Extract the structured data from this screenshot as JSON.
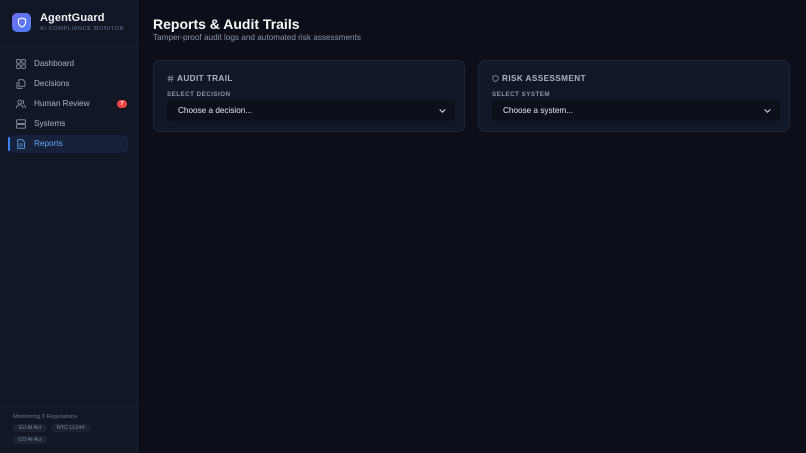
{
  "brand": {
    "name": "AgentGuard",
    "subtitle": "AI COMPLIANCE MONITOR",
    "logo_icon": "shield-icon"
  },
  "sidebar": {
    "items": [
      {
        "label": "Dashboard",
        "icon": "grid-icon",
        "active": false
      },
      {
        "label": "Decisions",
        "icon": "documents-icon",
        "active": false
      },
      {
        "label": "Human Review",
        "icon": "users-icon",
        "active": false,
        "badge": "7"
      },
      {
        "label": "Systems",
        "icon": "server-icon",
        "active": false
      },
      {
        "label": "Reports",
        "icon": "file-text-icon",
        "active": true
      }
    ],
    "footer": {
      "monitoring": "Monitoring 3 Regulations",
      "tags": [
        "EU AI Act",
        "NYC LL144",
        "CO AI Act"
      ]
    }
  },
  "page": {
    "title": "Reports & Audit Trails",
    "subtitle": "Tamper-proof audit logs and automated risk assessments"
  },
  "cards": {
    "audit": {
      "title": "AUDIT TRAIL",
      "icon": "hash-icon",
      "field_label": "SELECT DECISION",
      "placeholder": "Choose a decision..."
    },
    "risk": {
      "title": "RISK ASSESSMENT",
      "icon": "shield-icon",
      "field_label": "SELECT SYSTEM",
      "placeholder": "Choose a system..."
    }
  },
  "colors": {
    "background": "#0c0f19",
    "sidebar": "#121725",
    "accent": "#3b82f6",
    "active_text": "#60a5fa",
    "badge": "#ef4444",
    "logo_gradient": [
      "#6d6ef5",
      "#4f7cf3"
    ]
  }
}
